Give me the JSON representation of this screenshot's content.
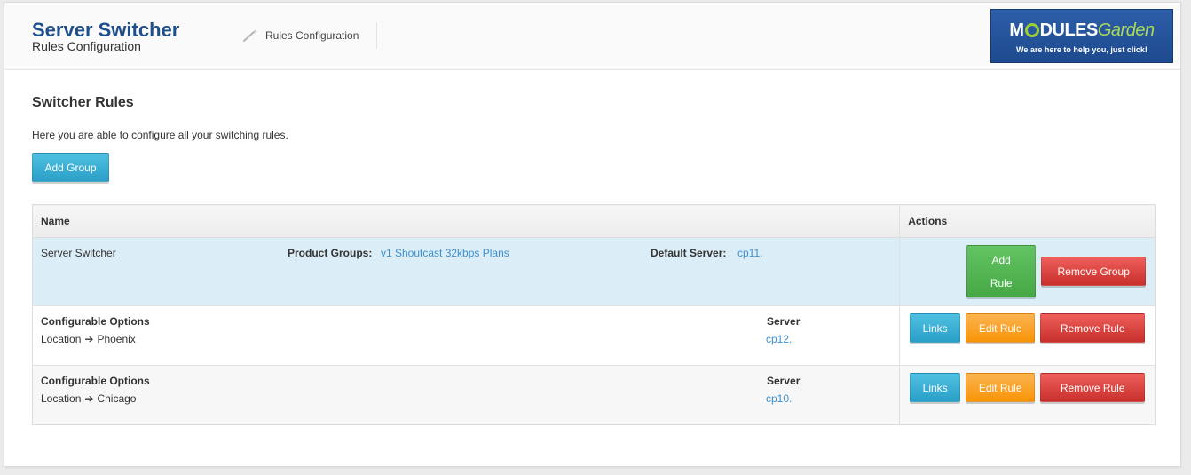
{
  "header": {
    "app_title": "Server Switcher",
    "app_subtitle": "Rules Configuration",
    "breadcrumb": "Rules Configuration",
    "logo": {
      "brand_pre": "M",
      "brand_post": "DULES",
      "brand_garden": "Garden",
      "tagline": "We are here to help you, just click!"
    }
  },
  "main": {
    "section_title": "Switcher Rules",
    "intro": "Here you are able to configure all your switching rules.",
    "add_group_label": "Add Group",
    "table": {
      "headers": {
        "name": "Name",
        "actions": "Actions"
      },
      "group": {
        "name": "Server Switcher",
        "product_groups_label": "Product Groups:",
        "product_groups_value": "v1 Shoutcast 32kbps Plans",
        "default_server_label": "Default Server:",
        "default_server_value": "cp11.",
        "add_rule_line1": "Add",
        "add_rule_line2": "Rule",
        "remove_group_label": "Remove Group"
      },
      "rules": [
        {
          "title": "Configurable Options",
          "option": "Location",
          "value": "Phoenix",
          "server_label": "Server",
          "server_value": "cp12.",
          "links_label": "Links",
          "edit_label": "Edit Rule",
          "remove_label": "Remove Rule"
        },
        {
          "title": "Configurable Options",
          "option": "Location",
          "value": "Chicago",
          "server_label": "Server",
          "server_value": "cp10.",
          "links_label": "Links",
          "edit_label": "Edit Rule",
          "remove_label": "Remove Rule"
        }
      ]
    }
  },
  "icons": {
    "breadcrumb": "magic-wand-icon",
    "arrow": "arrow-right-icon"
  },
  "colors": {
    "title_blue": "#1f4f8b",
    "link_blue": "#3b8fd0",
    "group_row_bg": "#dbedf6",
    "info": "#2a9fc8",
    "success": "#45a845",
    "warning": "#f89406",
    "danger": "#c9302c",
    "logo_bg": "#1e4a8e",
    "logo_accent": "#9bcf34"
  }
}
